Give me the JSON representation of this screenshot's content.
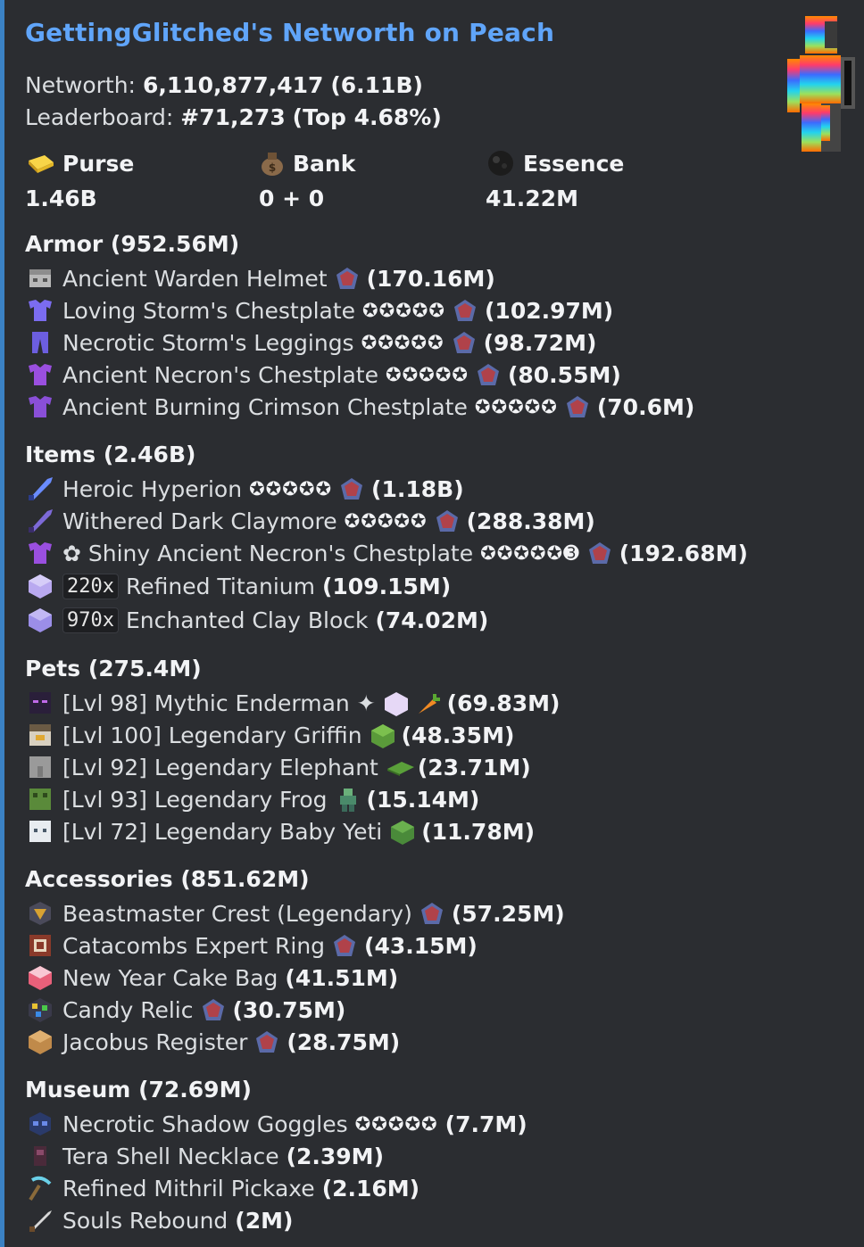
{
  "title": "GettingGlitched's Networth on Peach",
  "networth": {
    "label": "Networth:",
    "value": "6,110,877,417",
    "short": "(6.11B)"
  },
  "leaderboard": {
    "label": "Leaderboard:",
    "rank": "#71,273",
    "top": "(Top 4.68%)"
  },
  "fields": [
    {
      "name": "Purse",
      "value": "1.46B",
      "icon": "gold-ingot-icon"
    },
    {
      "name": "Bank",
      "value": "0 + 0",
      "icon": "bank-bag-icon"
    },
    {
      "name": "Essence",
      "value": "41.22M",
      "icon": "wither-essence-icon"
    }
  ],
  "sections": {
    "armor": {
      "header": "Armor (952.56M)",
      "items": [
        {
          "name": "Ancient Warden Helmet",
          "stars": "",
          "value": "(170.16M)",
          "gem": true
        },
        {
          "name": "Loving Storm's Chestplate",
          "stars": "✪✪✪✪✪",
          "value": "(102.97M)",
          "gem": true
        },
        {
          "name": "Necrotic Storm's Leggings",
          "stars": "✪✪✪✪✪",
          "value": "(98.72M)",
          "gem": true
        },
        {
          "name": "Ancient Necron's Chestplate",
          "stars": "✪✪✪✪✪",
          "value": "(80.55M)",
          "gem": true
        },
        {
          "name": "Ancient Burning Crimson Chestplate",
          "stars": "✪✪✪✪✪",
          "value": "(70.6M)",
          "gem": true
        }
      ]
    },
    "items": {
      "header": "Items (2.46B)",
      "items": [
        {
          "name": "Heroic Hyperion",
          "stars": "✪✪✪✪✪",
          "value": "(1.18B)",
          "gem": true
        },
        {
          "name": "Withered Dark Claymore",
          "stars": "✪✪✪✪✪",
          "value": "(288.38M)",
          "gem": true
        },
        {
          "name": "✿ Shiny Ancient Necron's Chestplate",
          "stars": "✪✪✪✪✪➌",
          "value": "(192.68M)",
          "gem": true
        },
        {
          "qty": "220x",
          "name": "Refined Titanium",
          "value": "(109.15M)"
        },
        {
          "qty": "970x",
          "name": "Enchanted Clay Block",
          "value": "(74.02M)"
        }
      ]
    },
    "pets": {
      "header": "Pets (275.4M)",
      "items": [
        {
          "name": "[Lvl 98] Mythic Enderman ✦",
          "value": "(69.83M)"
        },
        {
          "name": "[Lvl 100] Legendary Griffin",
          "value": "(48.35M)"
        },
        {
          "name": "[Lvl 92] Legendary Elephant",
          "value": "(23.71M)"
        },
        {
          "name": "[Lvl 93] Legendary Frog",
          "value": "(15.14M)"
        },
        {
          "name": "[Lvl 72] Legendary Baby Yeti",
          "value": "(11.78M)"
        }
      ]
    },
    "accessories": {
      "header": "Accessories (851.62M)",
      "items": [
        {
          "name": "Beastmaster Crest (Legendary)",
          "value": "(57.25M)"
        },
        {
          "name": "Catacombs Expert Ring",
          "value": "(43.15M)"
        },
        {
          "name": "New Year Cake Bag",
          "value": "(41.51M)"
        },
        {
          "name": "Candy Relic",
          "value": "(30.75M)"
        },
        {
          "name": "Jacobus Register",
          "value": "(28.75M)"
        }
      ]
    },
    "museum": {
      "header": "Museum (72.69M)",
      "items": [
        {
          "name": "Necrotic Shadow Goggles",
          "stars": "✪✪✪✪✪",
          "value": "(7.7M)"
        },
        {
          "name": "Tera Shell Necklace",
          "value": "(2.39M)"
        },
        {
          "name": "Refined Mithril Pickaxe",
          "value": "(2.16M)"
        },
        {
          "name": "Souls Rebound",
          "value": "(2M)"
        }
      ]
    }
  },
  "colors": {
    "background": "#2b2d31",
    "accent": "#3b82c4",
    "title": "#60a5fa"
  }
}
